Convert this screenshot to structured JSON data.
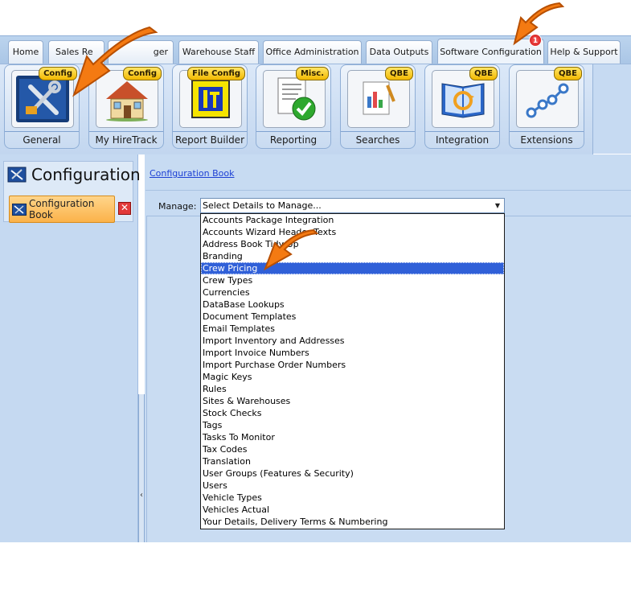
{
  "tabs": [
    {
      "label": "Home"
    },
    {
      "label": "Sales Re"
    },
    {
      "label": "ger"
    },
    {
      "label": "Warehouse Staff"
    },
    {
      "label": "Office Administration"
    },
    {
      "label": "Data Outputs"
    },
    {
      "label": "Software Configuration"
    },
    {
      "label": "Help & Support"
    }
  ],
  "notification_badge": "1",
  "ribbon": {
    "buttons": [
      {
        "label": "General",
        "tag": "Config",
        "icon": "tools-icon"
      },
      {
        "label": "My HireTrack",
        "tag": "Config",
        "icon": "house-icon"
      },
      {
        "label": "Report Builder",
        "tag": "File Config",
        "icon": "report-builder-icon"
      },
      {
        "label": "Reporting",
        "tag": "Misc.",
        "icon": "report-check-icon"
      },
      {
        "label": "Searches",
        "tag": "QBE",
        "icon": "search-document-icon"
      },
      {
        "label": "Integration",
        "tag": "QBE",
        "icon": "integration-book-icon"
      },
      {
        "label": "Extensions",
        "tag": "QBE",
        "icon": "extensions-nodes-icon"
      }
    ]
  },
  "sidebar": {
    "title": "Configuration",
    "item": {
      "label_line1": "Configuration",
      "label_line2": "Book"
    }
  },
  "main": {
    "breadcrumb": "Configuration Book",
    "manage_label": "Manage:",
    "select_value": "Select Details to Manage...",
    "options": [
      "Accounts Package Integration",
      "Accounts Wizard Header Texts",
      "Address Book Tidy Up",
      "Branding",
      "Crew Pricing",
      "Crew Types",
      "Currencies",
      "DataBase Lookups",
      "Document Templates",
      "Email Templates",
      "Import Inventory and Addresses",
      "Import Invoice Numbers",
      "Import Purchase Order Numbers",
      "Magic Keys",
      "Rules",
      "Sites & Warehouses",
      "Stock Checks",
      "Tags",
      "Tasks To Monitor",
      "Tax Codes",
      "Translation",
      "User Groups (Features & Security)",
      "Users",
      "Vehicle Types",
      "Vehicles Actual",
      "Your Details, Delivery Terms & Numbering"
    ],
    "selected_option": "Crew Pricing"
  },
  "colors": {
    "accent_orange": "#f47a12",
    "selection_blue": "#3060d8",
    "ribbon_blue": "#c6daf2"
  }
}
